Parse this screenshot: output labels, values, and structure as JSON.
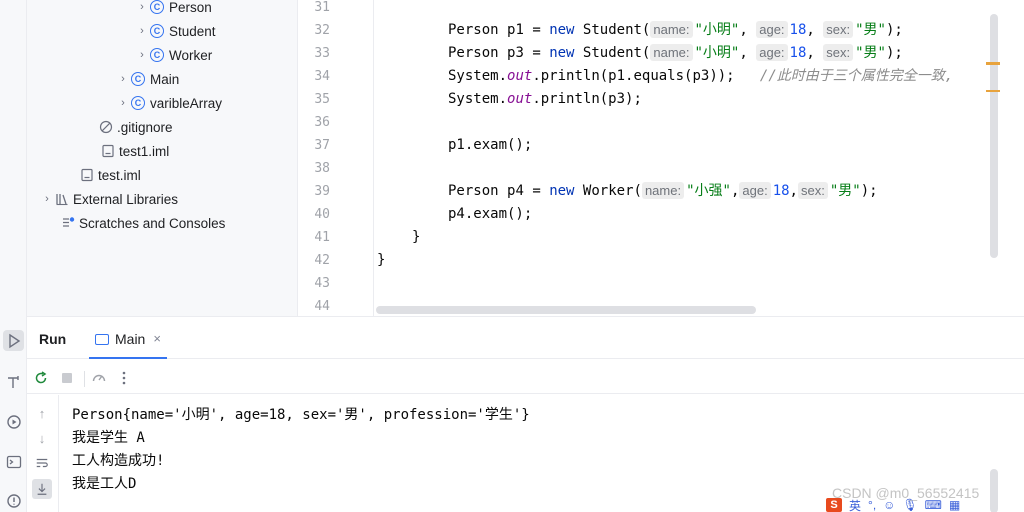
{
  "project_tree": {
    "items": [
      {
        "label": "Person",
        "kind": "class",
        "arrow": true
      },
      {
        "label": "Student",
        "kind": "class",
        "arrow": true
      },
      {
        "label": "Worker",
        "kind": "class",
        "arrow": true
      },
      {
        "label": "Main",
        "kind": "class",
        "arrow": true
      },
      {
        "label": "varibleArray",
        "kind": "class",
        "arrow": true
      },
      {
        "label": ".gitignore",
        "kind": "ignore",
        "arrow": false
      },
      {
        "label": "test1.iml",
        "kind": "file",
        "arrow": false
      },
      {
        "label": "test.iml",
        "kind": "file",
        "arrow": false
      },
      {
        "label": "External Libraries",
        "kind": "library",
        "arrow": true
      },
      {
        "label": "Scratches and Consoles",
        "kind": "scratch",
        "arrow": false
      }
    ]
  },
  "editor": {
    "line_numbers": [
      "31",
      "32",
      "33",
      "34",
      "35",
      "36",
      "37",
      "38",
      "39",
      "40",
      "41",
      "42",
      "43",
      "44"
    ],
    "line32": {
      "type": "Person",
      "var": "p1",
      "eq": "=",
      "kw": "new",
      "ctor": "Student(",
      "h1": "name:",
      "s1": "\"小明\"",
      "c1": ",",
      "h2": "age:",
      "n1": "18",
      "c2": ",",
      "h3": "sex:",
      "s2": "\"男\"",
      "end": ");"
    },
    "line33": {
      "type": "Person",
      "var": "p3",
      "eq": "=",
      "kw": "new",
      "ctor": "Student(",
      "h1": "name:",
      "s1": "\"小明\"",
      "c1": ",",
      "h2": "age:",
      "n1": "18",
      "c2": ",",
      "h3": "sex:",
      "s2": "\"男\"",
      "end": ");"
    },
    "line34": {
      "pre": "System.",
      "out": "out",
      "post": ".println(p1.equals(p3));",
      "comment": "//此时由于三个属性完全一致,"
    },
    "line35": {
      "pre": "System.",
      "out": "out",
      "post": ".println(p3);"
    },
    "line37": "p1.exam();",
    "line39": {
      "type": "Person",
      "var": "p4",
      "eq": "=",
      "kw": "new",
      "ctor": "Worker(",
      "h1": "name:",
      "s1": "\"小强\"",
      "c1": ",",
      "h2": "age:",
      "n1": "18",
      "c2": ",",
      "h3": "sex:",
      "s2": "\"男\"",
      "end": ");"
    },
    "line40": "p4.exam();",
    "line41": "}",
    "line42": "}"
  },
  "run_panel": {
    "title": "Run",
    "tab_label": "Main",
    "tab_close": "×",
    "output": [
      "Person{name='小明', age=18, sex='男', profession='学生'}",
      "我是学生 A",
      "工人构造成功!",
      "我是工人D"
    ]
  },
  "overlay": {
    "watermark": "CSDN @m0_56552415",
    "tray_s": "S",
    "tray_lang": "英"
  },
  "colors": {
    "accent": "#3574f0",
    "keyword": "#0033b3",
    "string": "#067d17",
    "number": "#1750eb",
    "field": "#871094",
    "comment": "#8c8c8c"
  }
}
